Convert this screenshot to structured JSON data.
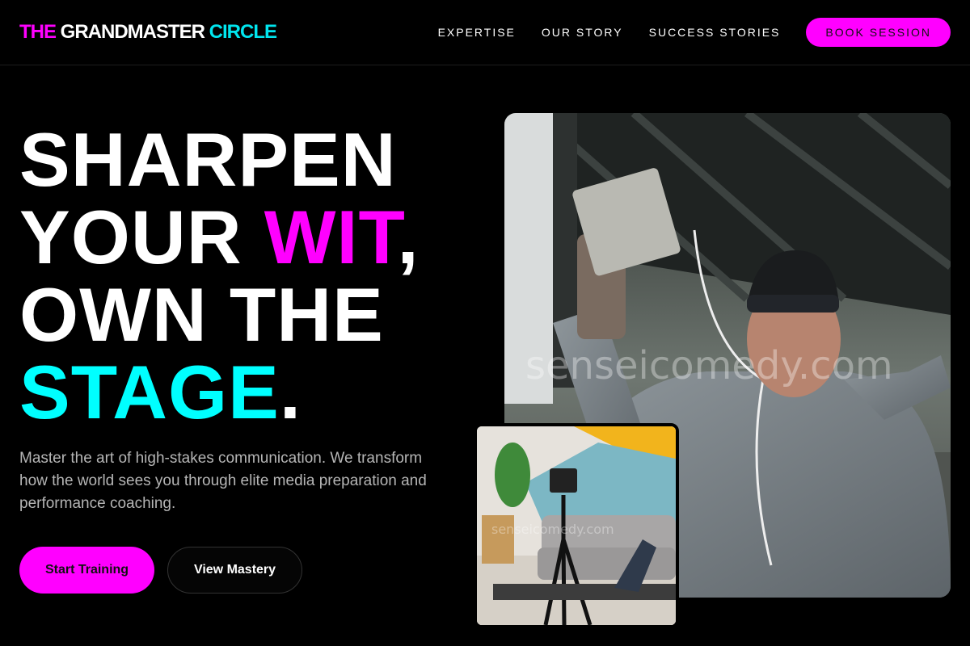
{
  "brand": {
    "part1": "THE",
    "part2": " GRANDMASTER ",
    "part3": "CIRCLE"
  },
  "nav": {
    "items": [
      "EXPERTISE",
      "OUR STORY",
      "SUCCESS STORIES"
    ],
    "cta": "BOOK SESSION"
  },
  "hero": {
    "line1": "SHARPEN",
    "line2a": "YOUR ",
    "line2b": "WIT",
    ",": ",",
    "line2c": ",",
    "line3": "OWN THE",
    "line4a": "STAGE",
    "line4b": "."
  },
  "lead": "Master the art of high-stakes communication. We transform how the world sees you through elite media preparation and performance coaching.",
  "buttons": {
    "primary": "Start Training",
    "secondary": "View Mastery"
  },
  "watermark": "senseicomedy.com",
  "colors": {
    "accent_magenta": "#ff00ff",
    "accent_cyan": "#00ffff",
    "background": "#000000"
  }
}
